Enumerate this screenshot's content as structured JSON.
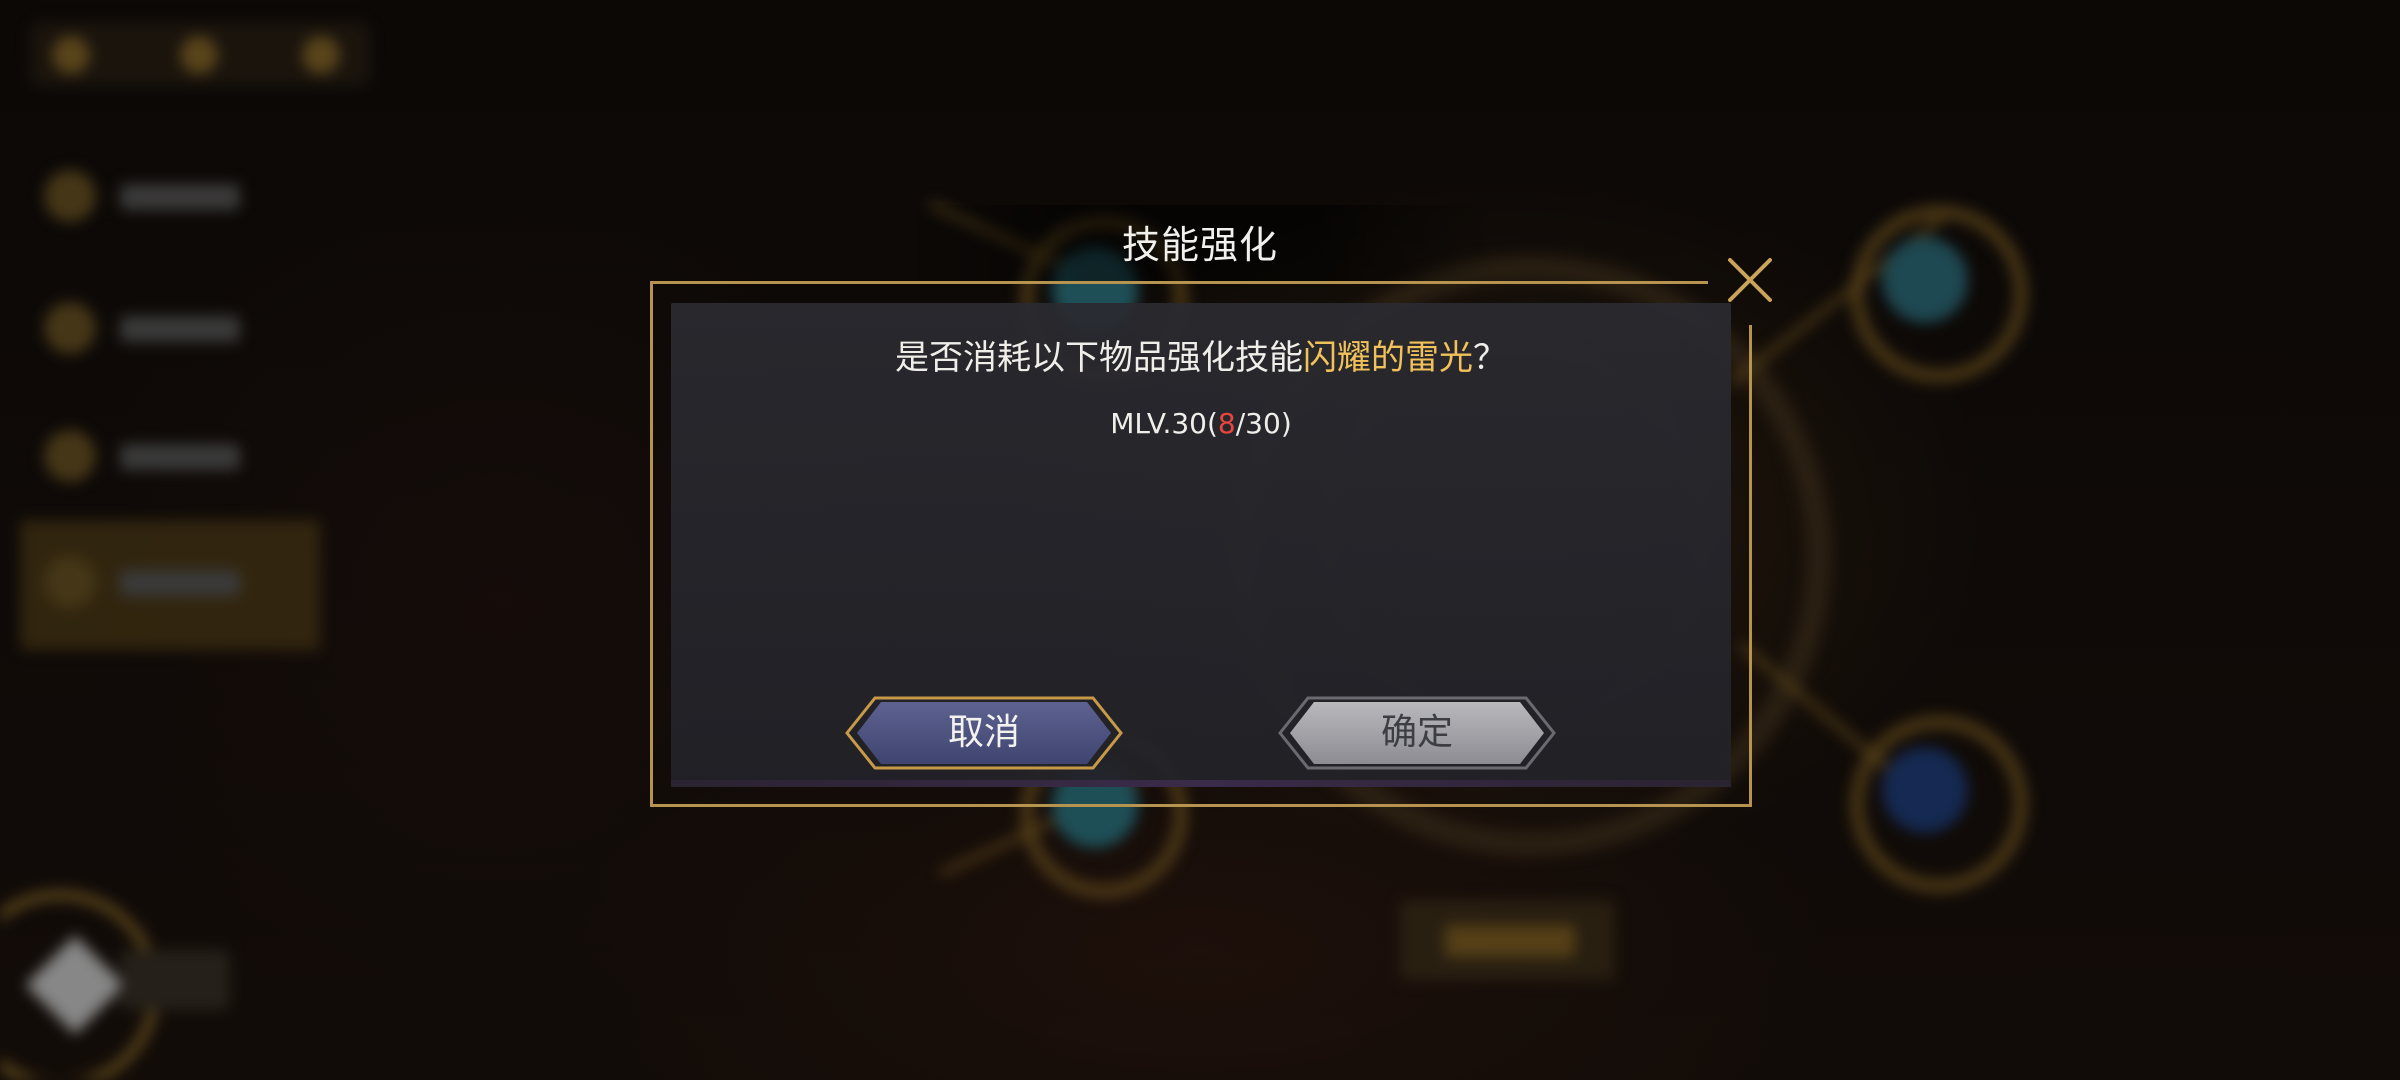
{
  "dialog": {
    "title": "技能强化",
    "question_prefix": "是否消耗以下物品强化技能",
    "skill_name": "闪耀的雷光",
    "question_suffix": "？",
    "level_prefix": "MLV.30(",
    "level_current": "8",
    "level_suffix": "/30)",
    "cancel_label": "取消",
    "confirm_label": "确定"
  },
  "colors": {
    "accent_gold": "#b6944f",
    "skill_highlight": "#f2c25a",
    "level_current": "#e8453c"
  },
  "icons": {
    "close": "close-x-icon"
  }
}
